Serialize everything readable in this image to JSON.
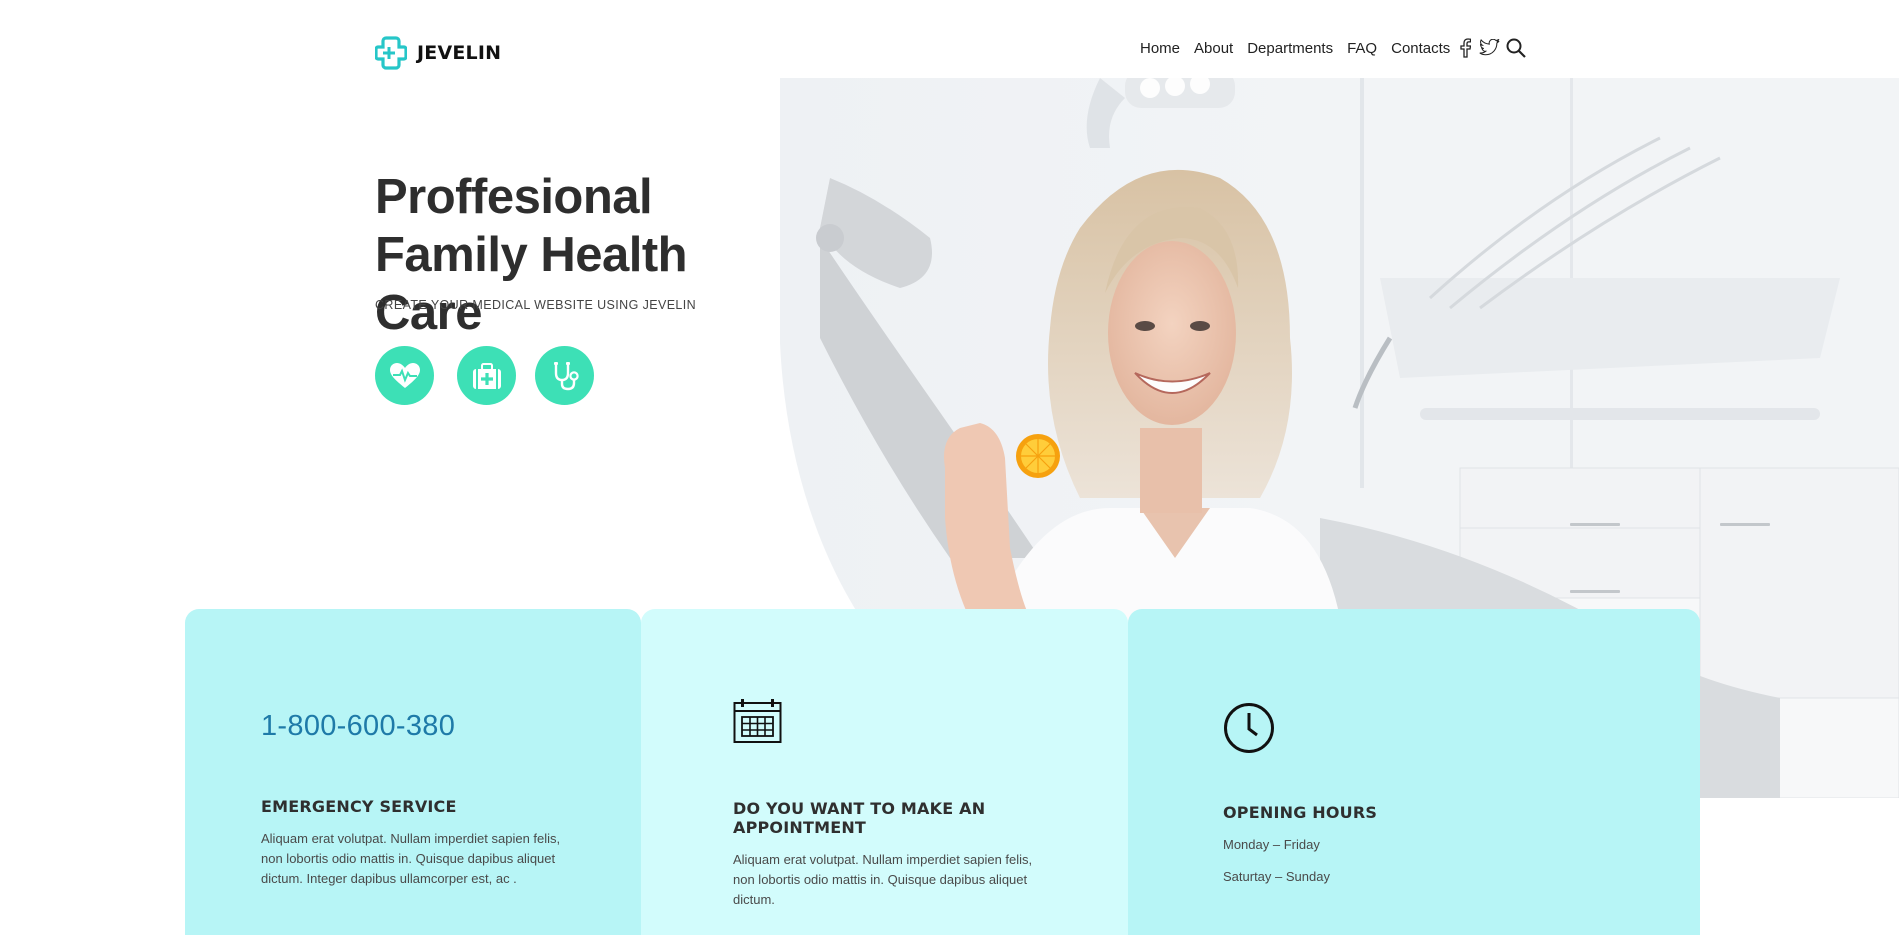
{
  "brand": {
    "name": "JEVELIN",
    "logo_icon": "medical-cross-icon",
    "accent": "#3de0b6"
  },
  "nav": {
    "items": [
      {
        "label": "Home"
      },
      {
        "label": "About"
      },
      {
        "label": "Departments"
      },
      {
        "label": "FAQ"
      },
      {
        "label": "Contacts"
      }
    ],
    "icons": [
      "facebook-icon",
      "twitter-icon",
      "search-icon"
    ]
  },
  "hero": {
    "title_line1": "Proffesional",
    "title_line2": "Family Health Care",
    "subtitle": "CREATE YOUR MEDICAL WEBSITE USING JEVELIN",
    "icons": [
      "heartbeat-icon",
      "first-aid-kit-icon",
      "stethoscope-icon"
    ],
    "photo": "smiling-woman-dental-office-photo"
  },
  "cards": {
    "emergency": {
      "phone": "1-800-600-380",
      "title": "EMERGENCY SERVICE",
      "text": "Aliquam erat volutpat. Nullam imperdiet sapien felis, non lobortis odio mattis in. Quisque dapibus aliquet dictum. Integer dapibus ullamcorper est, ac ."
    },
    "appointment": {
      "icon": "calendar-icon",
      "title": "DO YOU WANT TO MAKE AN APPOINTMENT",
      "text": "Aliquam erat volutpat. Nullam imperdiet sapien felis, non lobortis odio mattis in. Quisque dapibus aliquet dictum."
    },
    "hours": {
      "icon": "clock-icon",
      "title": "OPENING HOURS",
      "weekdays": "Monday – Friday",
      "weekend": "Saturtay – Sunday"
    }
  },
  "colors": {
    "card_primary": "#b7f5f6",
    "card_light": "#d2fcfc",
    "phone": "#1e7aa8"
  }
}
